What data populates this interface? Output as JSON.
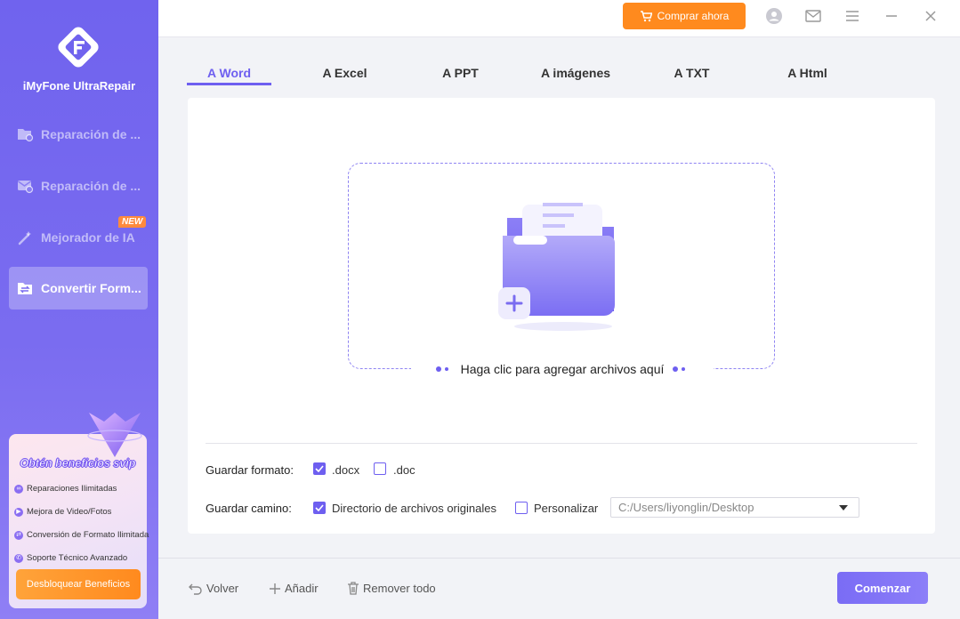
{
  "app": {
    "name": "iMyFone UltraRepair"
  },
  "sidebar": {
    "items": [
      {
        "label": "Reparación de ...",
        "icon": "file-repair-icon",
        "active": false
      },
      {
        "label": "Reparación de ...",
        "icon": "mail-repair-icon",
        "active": false
      },
      {
        "label": "Mejorador de IA",
        "icon": "magic-wand-icon",
        "active": false,
        "badge": "NEW"
      },
      {
        "label": "Convertir Form...",
        "icon": "convert-icon",
        "active": true
      }
    ],
    "promo": {
      "title": "Obtén beneficios svip",
      "perks": [
        "Reparaciones Ilimitadas",
        "Mejora de Video/Fotos",
        "Conversión de Formato Ilimitada",
        "Soporte Técnico Avanzado"
      ],
      "button": "Desbloquear Beneficios"
    }
  },
  "topbar": {
    "buy_label": "Comprar ahora",
    "icons": [
      "user-icon",
      "mail-icon",
      "menu-icon",
      "minimize-icon",
      "close-icon"
    ]
  },
  "tabs": [
    {
      "label": "A Word",
      "active": true
    },
    {
      "label": "A Excel",
      "active": false
    },
    {
      "label": "A PPT",
      "active": false
    },
    {
      "label": "A imágenes",
      "active": false
    },
    {
      "label": "A TXT",
      "active": false
    },
    {
      "label": "A Html",
      "active": false
    }
  ],
  "dropzone": {
    "text": "Haga clic para agregar archivos aquí"
  },
  "options": {
    "format_label": "Guardar formato:",
    "formats": [
      {
        "label": ".docx",
        "checked": true
      },
      {
        "label": ".doc",
        "checked": false
      }
    ],
    "path_label": "Guardar camino:",
    "path_options": [
      {
        "label": "Directorio de archivos originales",
        "checked": true
      },
      {
        "label": "Personalizar",
        "checked": false
      }
    ],
    "path_value": "C:/Users/liyonglin/Desktop"
  },
  "bottom": {
    "back_label": "Volver",
    "add_label": "Añadir",
    "remove_label": "Remover todo",
    "start_label": "Comenzar"
  },
  "colors": {
    "accent": "#6e5ff0",
    "orange": "#ff8a1e",
    "sidebar": "#7063ee"
  }
}
